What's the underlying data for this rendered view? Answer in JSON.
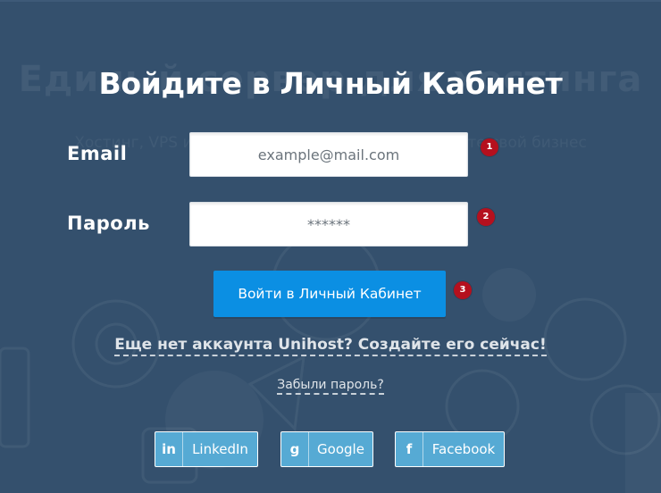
{
  "background": {
    "heading": "Единый сервер для хостинга",
    "subheading": "Хостинг, VPS и серверы — всё, пока вы развиваете свой бизнес"
  },
  "form": {
    "title": "Войдите в Личный Кабинет",
    "email_label": "Email",
    "email_placeholder": "example@mail.com",
    "password_label": "Пароль",
    "password_placeholder": "******",
    "submit_label": "Войти в Личный Кабинет",
    "register_link": "Еще нет аккаунта Unihost? Создайте его сейчас!",
    "forgot_link": "Забыли пароль?"
  },
  "badges": [
    "1",
    "2",
    "3"
  ],
  "social": [
    {
      "icon": "linkedin-icon",
      "glyph": "in",
      "label": "LinkedIn"
    },
    {
      "icon": "google-icon",
      "glyph": "g",
      "label": "Google"
    },
    {
      "icon": "facebook-icon",
      "glyph": "f",
      "label": "Facebook"
    }
  ],
  "colors": {
    "overlay": "#34506d",
    "submit": "#0b8fe3",
    "badge": "#b5101e",
    "social": "#56aad4"
  }
}
